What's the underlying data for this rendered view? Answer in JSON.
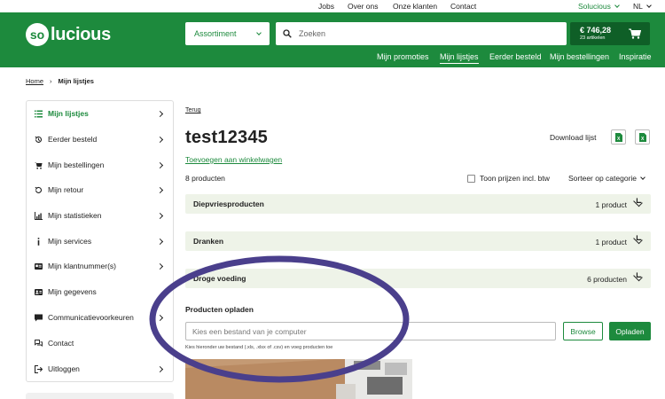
{
  "topbar": {
    "links": [
      "Jobs",
      "Over ons",
      "Onze klanten",
      "Contact"
    ],
    "account": "Solucious",
    "language": "NL"
  },
  "header": {
    "logo_mark": "so",
    "logo_text": "lucious",
    "assortiment_label": "Assortiment",
    "search_placeholder": "Zoeken",
    "cart_amount": "€ 746,28",
    "cart_count": "23 artikelen",
    "nav": [
      "Mijn promoties",
      "Mijn lijstjes",
      "Eerder besteld",
      "Mijn bestellingen",
      "Inspiratie"
    ],
    "nav_active": "Mijn lijstjes"
  },
  "breadcrumb": {
    "home": "Home",
    "current": "Mijn lijstjes"
  },
  "sidebar": {
    "items": [
      {
        "label": "Mijn lijstjes",
        "icon": "list-icon"
      },
      {
        "label": "Eerder besteld",
        "icon": "history-icon"
      },
      {
        "label": "Mijn bestellingen",
        "icon": "cart-icon"
      },
      {
        "label": "Mijn retour",
        "icon": "return-icon"
      },
      {
        "label": "Mijn statistieken",
        "icon": "chart-icon"
      },
      {
        "label": "Mijn services",
        "icon": "info-icon"
      },
      {
        "label": "Mijn klantnummer(s)",
        "icon": "id-card-icon"
      },
      {
        "label": "Mijn gegevens",
        "icon": "contact-card-icon"
      },
      {
        "label": "Communicatievoorkeuren",
        "icon": "chat-icon"
      },
      {
        "label": "Contact",
        "icon": "chat-bubbles-icon"
      },
      {
        "label": "Uitloggen",
        "icon": "logout-icon"
      }
    ]
  },
  "main": {
    "back_link": "Terug",
    "title": "test12345",
    "download_label": "Download lijst",
    "add_to_cart": "Toevoegen aan winkelwagen",
    "product_count": "8 producten",
    "show_prices_label": "Toon prijzen incl. btw",
    "sort_label": "Sorteer op categorie",
    "categories": [
      {
        "name": "Diepvriesproducten",
        "qty": "1 product"
      },
      {
        "name": "Dranken",
        "qty": "1 product"
      },
      {
        "name": "Droge voeding",
        "qty": "6 producten"
      }
    ],
    "upload": {
      "title": "Producten opladen",
      "placeholder": "Kies een bestand van je computer",
      "browse": "Browse",
      "submit": "Opladen",
      "hint": "Kies hieronder uw bestand (.xls, .xlsx of .csv) en voeg producten toe"
    }
  },
  "colors": {
    "brand_green": "#1d8a3d",
    "dark_green": "#0f5f27",
    "category_bg": "#eef3e8",
    "annotation_circle": "#4a3f8c"
  }
}
